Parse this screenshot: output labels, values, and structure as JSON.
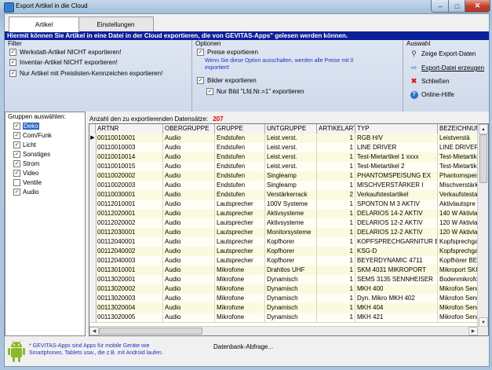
{
  "window": {
    "title": "Export Artikel in die Cloud",
    "close_glyph": "✕"
  },
  "tabs": [
    {
      "label": "Artikel",
      "active": true
    },
    {
      "label": "Einstellungen",
      "active": false
    }
  ],
  "info_text": "Hiermit können Sie Artikel in eine Datei in der Cloud exportieren, die von GEVITAS-Apps\" gelesen werden können.",
  "filter": {
    "title": "Filter",
    "options": [
      {
        "label": "Werkstatt-Artikel NICHT exportieren!",
        "checked": true
      },
      {
        "label": "Inventar-Artikel NICHT exportieren!",
        "checked": true
      },
      {
        "label": "Nur Artikel mit Preislisten-Kennzeichen exportieren!",
        "checked": true
      }
    ]
  },
  "optionen": {
    "title": "Optionen",
    "preise": {
      "label": "Preise exportieren",
      "checked": true
    },
    "preise_note": [
      "Wenn Sie diese Option ausschalten, werden alle Preise mit 0",
      "exportiert!"
    ],
    "bilder": {
      "label": "Bilder exportieren",
      "checked": true
    },
    "nur_bild": {
      "label": "Nur Bild \"Lfd.Nr.=1\" exportieren",
      "checked": true
    }
  },
  "auswahl": {
    "title": "Auswahl",
    "actions": [
      {
        "label": "Zeige Export-Daten",
        "icon": "magnifier-icon"
      },
      {
        "label": "Export-Datei erzeugen",
        "icon": "export-icon"
      },
      {
        "label": "Schließen",
        "icon": "close-x-icon"
      },
      {
        "label": "Online-Hilfe",
        "icon": "help-icon"
      }
    ]
  },
  "gruppen": {
    "title": "Gruppen auswählen:",
    "items": [
      {
        "label": "Deko",
        "checked": true,
        "selected": true
      },
      {
        "label": "Com/Funk",
        "checked": true
      },
      {
        "label": "Licht",
        "checked": true
      },
      {
        "label": "Sonstiges",
        "checked": true
      },
      {
        "label": "Strom",
        "checked": true
      },
      {
        "label": "Video",
        "checked": true
      },
      {
        "label": "Ventile",
        "checked": false
      },
      {
        "label": "Audio",
        "checked": true
      }
    ]
  },
  "count": {
    "label": "Anzahl den zu exportierenden Datensätze:",
    "value": "207"
  },
  "grid": {
    "current_row_marker": "▶",
    "columns": [
      "ARTNR",
      "OBERGRUPPE",
      "GRUPPE",
      "UNTGRUPPE",
      "ARTIKELART",
      "TYP",
      "BEZEICHNUN"
    ],
    "rows": [
      [
        "00110010001",
        "Audio",
        "Endstufen",
        "Leist.verst.",
        "1",
        "RGB H/V",
        "Leistverstä"
      ],
      [
        "00110010003",
        "Audio",
        "Endstufen",
        "Leist.verst.",
        "1",
        "LINE DRIVER",
        "LINE DRIVER"
      ],
      [
        "00110010014",
        "Audio",
        "Endstufen",
        "Leist.verst.",
        "1",
        "Test-Mietartikel 1 xxxx",
        "Test-Mietartikel"
      ],
      [
        "00110010015",
        "Audio",
        "Endstufen",
        "Leist.verst.",
        "1",
        "Test-Mietartikel 2",
        "Test-Mietartikel"
      ],
      [
        "00110020002",
        "Audio",
        "Endstufen",
        "Singleamp",
        "1",
        "PHANTOMSPEISUNG EX",
        "Phantomspeis"
      ],
      [
        "00110020003",
        "Audio",
        "Endstufen",
        "Singleamp",
        "1",
        "MISCHVERSTÄRKER I",
        "Mischverstärk"
      ],
      [
        "00110030001",
        "Audio",
        "Endstufen",
        "Verstärkerrack",
        "2",
        "Verkaufstestartikel",
        "Verkaufstestar"
      ],
      [
        "00112010001",
        "Audio",
        "Lautsprecher",
        "100V Systeme",
        "1",
        "SPONTON M 3 AKTIV",
        "Aktivlautspre"
      ],
      [
        "00112020001",
        "Audio",
        "Lautsprecher",
        "Aktivsysteme",
        "1",
        "DELARIOS 14-2 AKTIV",
        "140 W Aktivla"
      ],
      [
        "00112020002",
        "Audio",
        "Lautsprecher",
        "Aktivsysteme",
        "1",
        "DELARIOS 12-2 AKTIV",
        "120 W Aktivla"
      ],
      [
        "00112030001",
        "Audio",
        "Lautsprecher",
        "Monitorsysteme",
        "1",
        "DELARIOS 12-2 AKTIV",
        "120 W Aktivla"
      ],
      [
        "00112040001",
        "Audio",
        "Lautsprecher",
        "Kopfhorer",
        "1",
        "KOPFSPRECHGARNITUR E",
        "Kopfsprechga"
      ],
      [
        "00112040002",
        "Audio",
        "Lautsprecher",
        "Kopfhorer",
        "1",
        "KSG-D",
        "Kopfsprechga"
      ],
      [
        "00112040003",
        "Audio",
        "Lautsprecher",
        "Kopfhorer",
        "1",
        "BEYERDYNAMIC 4711",
        "Kopfhörer BE"
      ],
      [
        "00113010001",
        "Audio",
        "Mikrofone",
        "Drahtlos UHF",
        "1",
        "SKM 4031 MIKROPORT",
        "Mikroport SKI"
      ],
      [
        "00113020001",
        "Audio",
        "Mikrofone",
        "Dynamisch",
        "1",
        "SEMS 3135 SENNHEISER",
        "Bodenmikrofo"
      ],
      [
        "00113020002",
        "Audio",
        "Mikrofone",
        "Dynamisch",
        "1",
        "MKH 400",
        "Mikrofon Senn"
      ],
      [
        "00113020003",
        "Audio",
        "Mikrofone",
        "Dynamisch",
        "1",
        "Dyn. Mikro MKH 402",
        "Mikrofon Senn"
      ],
      [
        "00113020004",
        "Audio",
        "Mikrofone",
        "Dynamisch",
        "1",
        "MKH 404",
        "Mikrofon Senn"
      ],
      [
        "00113020005",
        "Audio",
        "Mikrofone",
        "Dynamisch",
        "1",
        "MKH 421",
        "Mikrofon Senn"
      ]
    ]
  },
  "footer": {
    "note": [
      "* GEVITAS-Apps sind Apps für mobile Geräte wie",
      "Smartphones, Tablets usw., die z.B. mit Android laufen."
    ],
    "status": "Datenbank-Abfrage..."
  },
  "colors": {
    "info_bar": "#0a1f9a",
    "count_value": "#e00000",
    "note_text": "#2030c0"
  }
}
